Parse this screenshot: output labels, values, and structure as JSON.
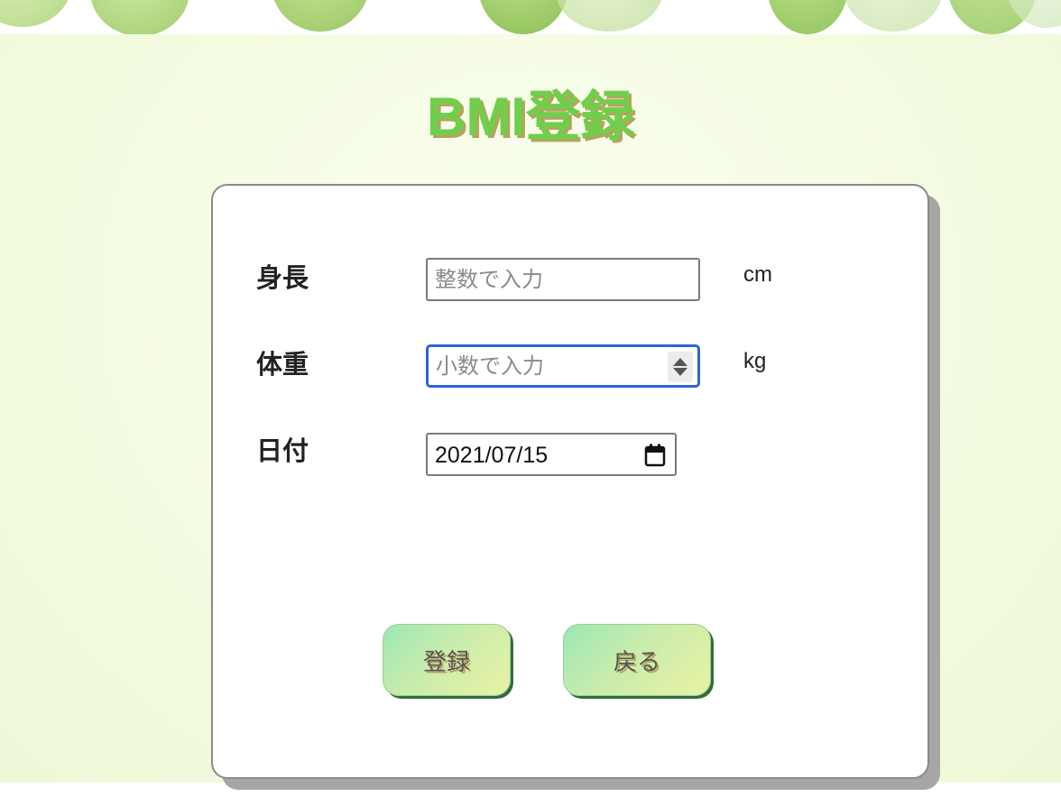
{
  "header": {
    "title": "BMI登録"
  },
  "form": {
    "height": {
      "label": "身長",
      "placeholder": "整数で入力",
      "value": "",
      "unit": "cm"
    },
    "weight": {
      "label": "体重",
      "placeholder": "小数で入力",
      "value": "",
      "unit": "kg"
    },
    "date": {
      "label": "日付",
      "value": "2021/07/15"
    }
  },
  "actions": {
    "register_label": "登録",
    "back_label": "戻る"
  },
  "icons": {
    "spinner": "number-spinner-icon",
    "calendar": "calendar-icon"
  },
  "colors": {
    "title": "#6fcf4b",
    "focus_border": "#2f62d6",
    "button_gradient_start": "#9ce8b4",
    "button_gradient_end": "#e9f2a3",
    "card_shadow": "#a9a5a5"
  }
}
